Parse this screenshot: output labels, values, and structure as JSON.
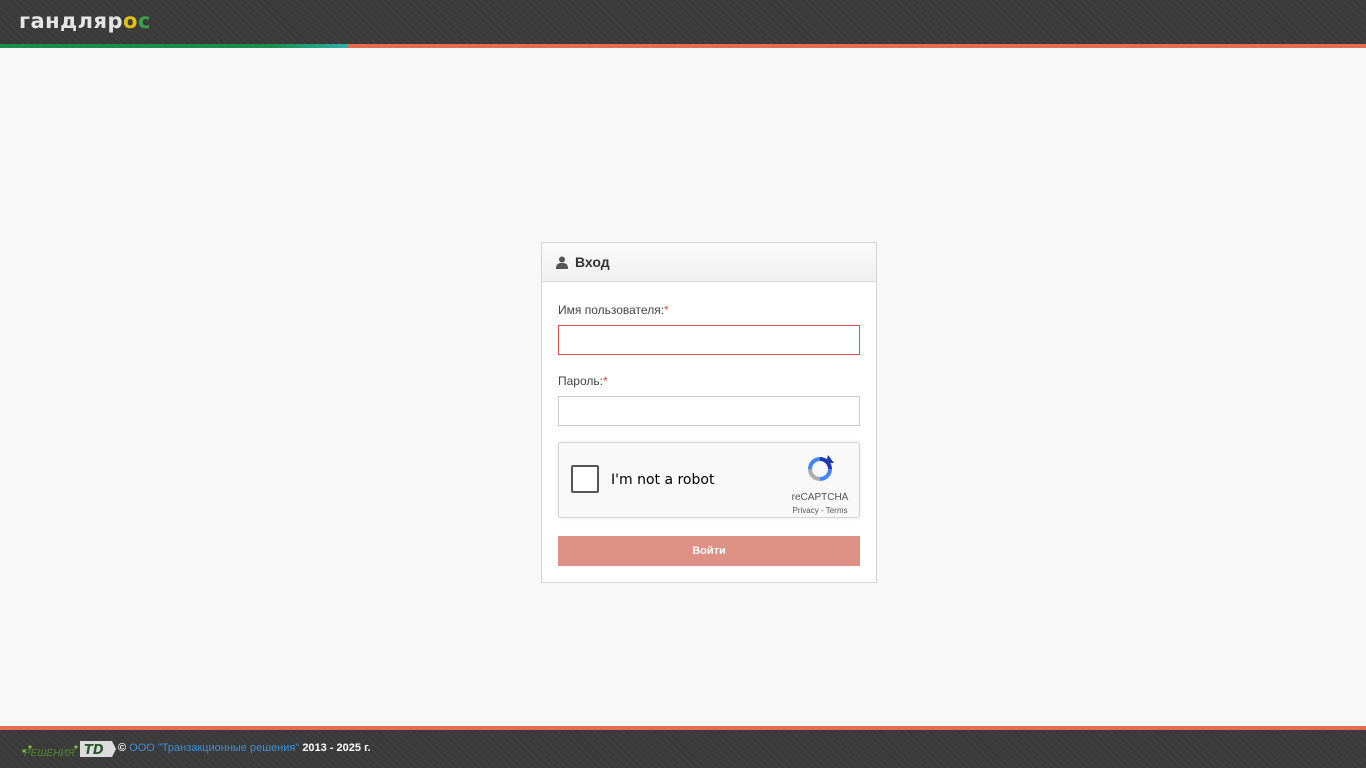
{
  "header": {
    "logo_main": "гандляр",
    "logo_o": "о",
    "logo_c": "с"
  },
  "login": {
    "title": "Вход",
    "username_label": "Имя пользователя:",
    "password_label": "Пароль:",
    "required_mark": "*",
    "username_value": "",
    "password_value": "",
    "submit_label": "Войти"
  },
  "captcha": {
    "checkbox_text": "I'm not a robot",
    "brand": "reCAPTCHA",
    "privacy": "Privacy",
    "separator": " - ",
    "terms": "Terms"
  },
  "footer": {
    "logo_text": "РЕШЕНИЯ",
    "copyright_symbol": "©",
    "company": "ООО \"Транзакционные решения\"",
    "years": "2013 -  2025 г."
  },
  "colors": {
    "accent_red": "#e86a52",
    "accent_green": "#1a8f4d",
    "button_disabled": "#de9085",
    "error_border": "#d9534f",
    "link_blue": "#3b8fd9"
  }
}
